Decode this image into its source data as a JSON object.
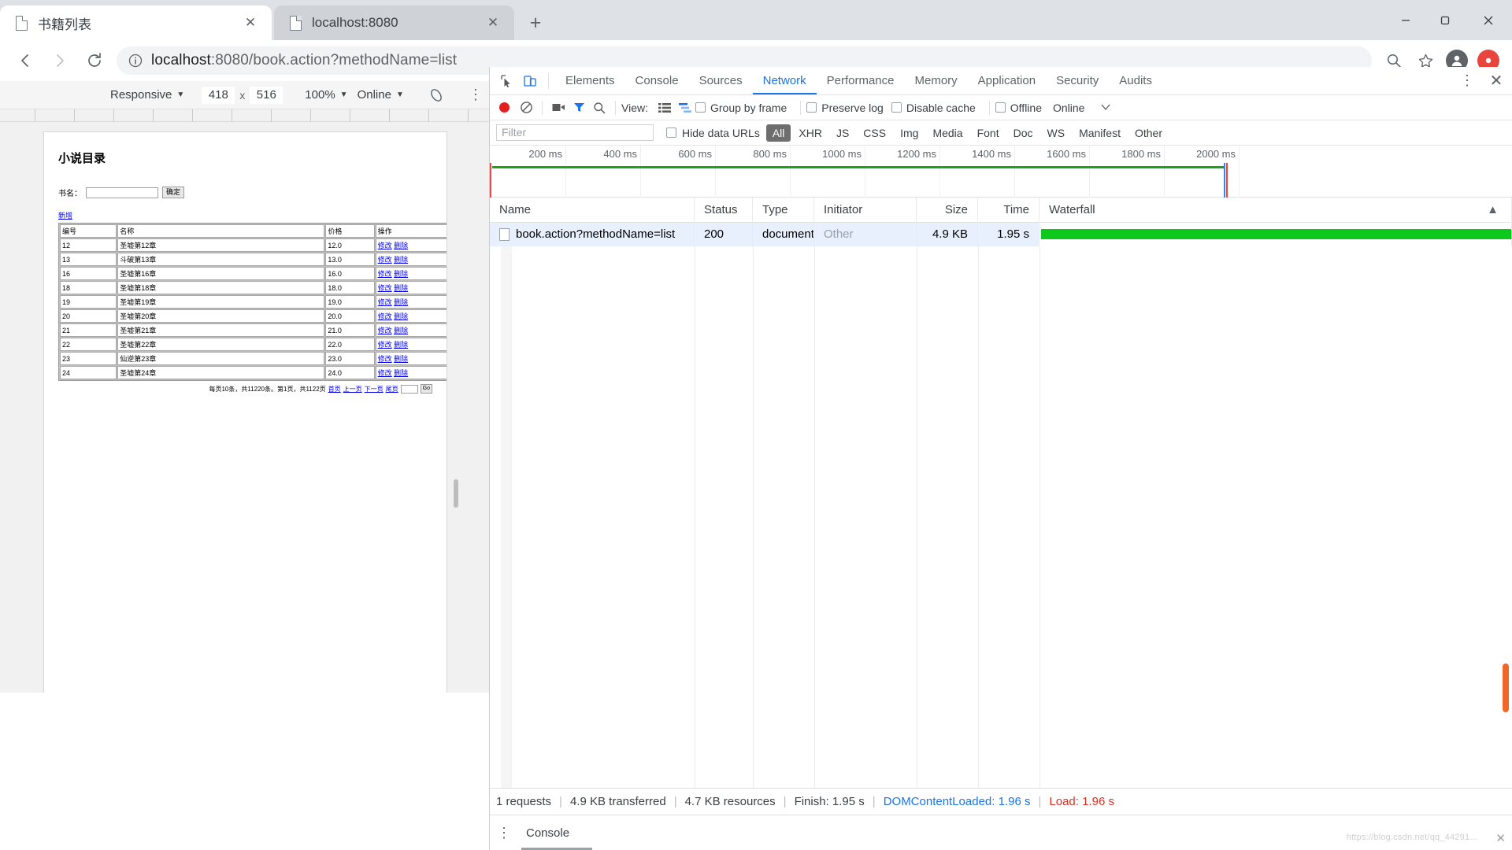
{
  "browser": {
    "tabs": [
      {
        "title": "书籍列表",
        "active": true,
        "close_label": "✕"
      },
      {
        "title": "localhost:8080",
        "active": false,
        "close_label": "✕"
      }
    ],
    "new_tab_label": "+",
    "omnibox": {
      "url_host": "localhost",
      "url_rest": ":8080/book.action?methodName=list",
      "full_url": "localhost:8080/book.action?methodName=list"
    }
  },
  "device_toolbar": {
    "device": "Responsive",
    "width": "418",
    "height": "516",
    "zoom": "100%",
    "throttle": "Online"
  },
  "page": {
    "title": "小说目录",
    "search": {
      "label": "书名：",
      "value": "",
      "placeholder": "",
      "submit_label": "确定"
    },
    "add_link": "新增",
    "table": {
      "headers": [
        "编号",
        "名称",
        "价格",
        "操作"
      ],
      "rows": [
        {
          "id": "12",
          "name": "圣墟第12章",
          "price": "12.0",
          "edit": "修改",
          "delete": "删除"
        },
        {
          "id": "13",
          "name": "斗破第13章",
          "price": "13.0",
          "edit": "修改",
          "delete": "删除"
        },
        {
          "id": "16",
          "name": "圣墟第16章",
          "price": "16.0",
          "edit": "修改",
          "delete": "删除"
        },
        {
          "id": "18",
          "name": "圣墟第18章",
          "price": "18.0",
          "edit": "修改",
          "delete": "删除"
        },
        {
          "id": "19",
          "name": "圣墟第19章",
          "price": "19.0",
          "edit": "修改",
          "delete": "删除"
        },
        {
          "id": "20",
          "name": "圣墟第20章",
          "price": "20.0",
          "edit": "修改",
          "delete": "删除"
        },
        {
          "id": "21",
          "name": "圣墟第21章",
          "price": "21.0",
          "edit": "修改",
          "delete": "删除"
        },
        {
          "id": "22",
          "name": "圣墟第22章",
          "price": "22.0",
          "edit": "修改",
          "delete": "删除"
        },
        {
          "id": "23",
          "name": "仙逆第23章",
          "price": "23.0",
          "edit": "修改",
          "delete": "删除"
        },
        {
          "id": "24",
          "name": "圣墟第24章",
          "price": "24.0",
          "edit": "修改",
          "delete": "删除"
        }
      ]
    },
    "pager": {
      "summary": "每页10条，共11220条。第1页，共1122页",
      "first": "首页",
      "prev": "上一页",
      "next": "下一页",
      "last": "尾页",
      "input_value": "",
      "go": "Go"
    }
  },
  "devtools": {
    "tabs": [
      {
        "label": "Elements",
        "active": false
      },
      {
        "label": "Console",
        "active": false
      },
      {
        "label": "Sources",
        "active": false
      },
      {
        "label": "Network",
        "active": true
      },
      {
        "label": "Performance",
        "active": false
      },
      {
        "label": "Memory",
        "active": false
      },
      {
        "label": "Application",
        "active": false
      },
      {
        "label": "Security",
        "active": false
      },
      {
        "label": "Audits",
        "active": false
      }
    ],
    "more_label": "⋮",
    "close_label": "✕",
    "network_toolbar": {
      "view_label": "View:",
      "group_by_frame": "Group by frame",
      "preserve_log": "Preserve log",
      "disable_cache": "Disable cache",
      "offline": "Offline",
      "throttle": "Online"
    },
    "filter_bar": {
      "filter_placeholder": "Filter",
      "hide_data_urls": "Hide data URLs",
      "types": [
        "All",
        "XHR",
        "JS",
        "CSS",
        "Img",
        "Media",
        "Font",
        "Doc",
        "WS",
        "Manifest",
        "Other"
      ],
      "selected_type": "All"
    },
    "overview_ticks": [
      "200 ms",
      "400 ms",
      "600 ms",
      "800 ms",
      "1000 ms",
      "1200 ms",
      "1400 ms",
      "1600 ms",
      "1800 ms",
      "2000 ms"
    ],
    "request_table": {
      "headers": [
        "Name",
        "Status",
        "Type",
        "Initiator",
        "Size",
        "Time",
        "Waterfall"
      ],
      "rows": [
        {
          "name": "book.action?methodName=list",
          "status": "200",
          "type": "document",
          "initiator": "Other",
          "size": "4.9 KB",
          "time": "1.95 s"
        }
      ]
    },
    "status_bar": {
      "requests": "1 requests",
      "transferred": "4.9 KB transferred",
      "resources": "4.7 KB resources",
      "finish": "Finish: 1.95 s",
      "dcl": "DOMContentLoaded: 1.96 s",
      "load": "Load: 1.96 s"
    },
    "drawer": {
      "console_label": "Console"
    }
  },
  "watermark": "https://blog.csdn.net/qq_44291...",
  "colors": {
    "accent_blue": "#1a73e8",
    "record_red": "#e32020",
    "waterfall_green": "#0cc91b",
    "status_red": "#d93025",
    "link_blue": "#0000ee"
  }
}
